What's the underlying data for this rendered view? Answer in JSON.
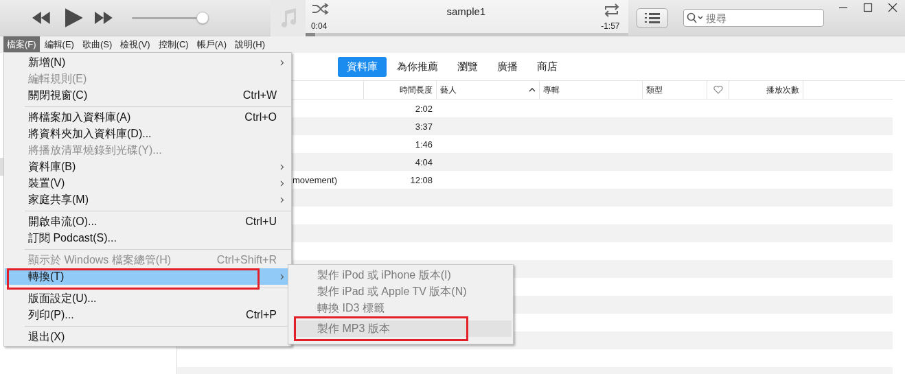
{
  "player": {
    "title": "sample1",
    "elapsed": "0:04",
    "remaining": "-1:57",
    "progress": {
      "level": 0.03
    },
    "volume": {
      "level": 0.93
    }
  },
  "search": {
    "placeholder": "搜尋"
  },
  "menubar": [
    {
      "label": "檔案(F)",
      "selected": true
    },
    {
      "label": "編輯(E)",
      "selected": false
    },
    {
      "label": "歌曲(S)",
      "selected": false
    },
    {
      "label": "檢視(V)",
      "selected": false
    },
    {
      "label": "控制(C)",
      "selected": false
    },
    {
      "label": "帳戶(A)",
      "selected": false
    },
    {
      "label": "說明(H)",
      "selected": false
    }
  ],
  "tabs": [
    {
      "label": "資料庫",
      "selected": true
    },
    {
      "label": "為你推薦",
      "selected": false
    },
    {
      "label": "瀏覽",
      "selected": false
    },
    {
      "label": "廣播",
      "selected": false
    },
    {
      "label": "商店",
      "selected": false
    }
  ],
  "table": {
    "columns": [
      {
        "kind": "blank"
      },
      {
        "kind": "numeric",
        "label": "時間長度",
        "sorted": false
      },
      {
        "kind": "text",
        "label": "藝人",
        "sorted": true
      },
      {
        "kind": "text",
        "label": "專輯",
        "sorted": false
      },
      {
        "kind": "text",
        "label": "類型",
        "sorted": false
      },
      {
        "kind": "heart"
      },
      {
        "kind": "numeric",
        "label": "播放次數",
        "sorted": false
      }
    ],
    "rows": [
      {
        "duration": "2:02"
      },
      {
        "duration": "3:37"
      },
      {
        "duration": "1:46"
      },
      {
        "duration": "4:04"
      },
      {
        "column_1": "movement)",
        "duration": "12:08"
      }
    ]
  },
  "file_menu": {
    "items": [
      {
        "kind": "item",
        "label": "新增(N)",
        "disabled": false,
        "submenu": true,
        "selected": false,
        "annotated": false
      },
      {
        "kind": "item",
        "label": "編輯規則(E)",
        "disabled": true,
        "submenu": false,
        "selected": false,
        "annotated": false
      },
      {
        "kind": "item",
        "label": "關閉視窗(C)",
        "shortcut": "Ctrl+W",
        "disabled": false,
        "submenu": false,
        "selected": false,
        "annotated": false
      },
      {
        "kind": "separator"
      },
      {
        "kind": "item",
        "label": "將檔案加入資料庫(A)",
        "shortcut": "Ctrl+O",
        "disabled": false,
        "submenu": false,
        "selected": false,
        "annotated": false
      },
      {
        "kind": "item",
        "label": "將資料夾加入資料庫(D)...",
        "disabled": false,
        "submenu": false,
        "selected": false,
        "annotated": false
      },
      {
        "kind": "item",
        "label": "將播放清單燒錄到光碟(Y)...",
        "disabled": true,
        "submenu": false,
        "selected": false,
        "annotated": false
      },
      {
        "kind": "item",
        "label": "資料庫(B)",
        "disabled": false,
        "submenu": true,
        "selected": false,
        "annotated": false
      },
      {
        "kind": "item",
        "label": "裝置(V)",
        "disabled": false,
        "submenu": true,
        "selected": false,
        "annotated": false
      },
      {
        "kind": "item",
        "label": "家庭共享(M)",
        "disabled": false,
        "submenu": true,
        "selected": false,
        "annotated": false
      },
      {
        "kind": "separator"
      },
      {
        "kind": "item",
        "label": "開啟串流(O)...",
        "shortcut": "Ctrl+U",
        "disabled": false,
        "submenu": false,
        "selected": false,
        "annotated": false
      },
      {
        "kind": "item",
        "label": "訂閱 Podcast(S)...",
        "disabled": false,
        "submenu": false,
        "selected": false,
        "annotated": false
      },
      {
        "kind": "separator"
      },
      {
        "kind": "item",
        "label": "顯示於 Windows 檔案總管(H)",
        "shortcut": "Ctrl+Shift+R",
        "disabled": true,
        "submenu": false,
        "selected": false,
        "annotated": false
      },
      {
        "kind": "item",
        "label": "轉換(T)",
        "disabled": false,
        "submenu": true,
        "selected": true,
        "annotated": true
      },
      {
        "kind": "separator"
      },
      {
        "kind": "item",
        "label": "版面設定(U)...",
        "disabled": false,
        "submenu": false,
        "selected": false,
        "annotated": false
      },
      {
        "kind": "item",
        "label": "列印(P)...",
        "shortcut": "Ctrl+P",
        "disabled": false,
        "submenu": false,
        "selected": false,
        "annotated": false
      },
      {
        "kind": "separator"
      },
      {
        "kind": "item",
        "label": "退出(X)",
        "disabled": false,
        "submenu": false,
        "selected": false,
        "annotated": false
      }
    ]
  },
  "convert_submenu": {
    "items": [
      {
        "label": "製作 iPod 或 iPhone 版本(I)",
        "disabled": true,
        "selected": false,
        "annotated": false
      },
      {
        "label": "製作 iPad 或 Apple TV 版本(N)",
        "disabled": true,
        "selected": false,
        "annotated": false
      },
      {
        "label": "轉換 ID3 標籤",
        "disabled": true,
        "selected": false,
        "annotated": false
      },
      {
        "label": "製作 MP3 版本",
        "disabled": true,
        "selected": true,
        "annotated": true
      }
    ]
  }
}
